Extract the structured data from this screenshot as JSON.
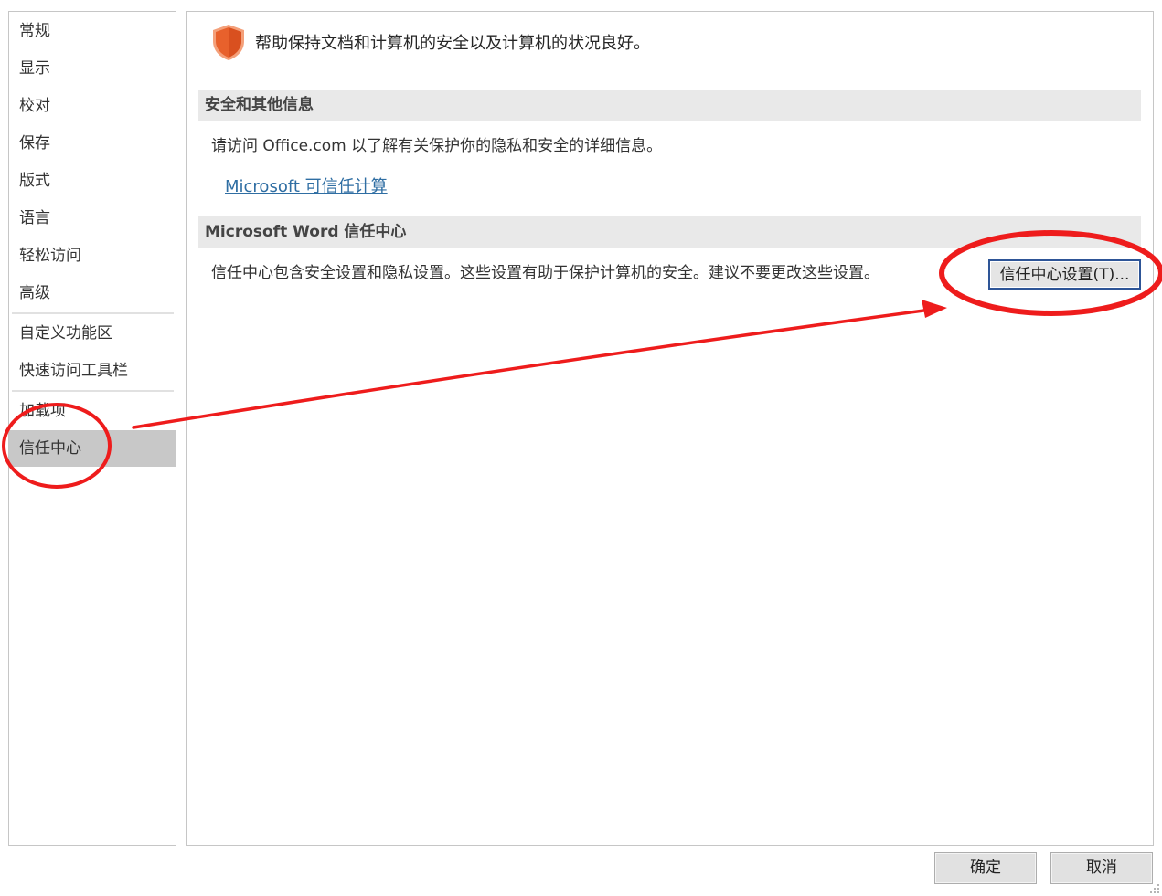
{
  "sidebar": {
    "items": [
      {
        "label": "常规"
      },
      {
        "label": "显示"
      },
      {
        "label": "校对"
      },
      {
        "label": "保存"
      },
      {
        "label": "版式"
      },
      {
        "label": "语言"
      },
      {
        "label": "轻松访问"
      },
      {
        "label": "高级"
      },
      {
        "label": "自定义功能区"
      },
      {
        "label": "快速访问工具栏"
      },
      {
        "label": "加载项"
      },
      {
        "label": "信任中心",
        "selected": true
      }
    ]
  },
  "main": {
    "intro": "帮助保持文档和计算机的安全以及计算机的状况良好。",
    "section1": {
      "title": "安全和其他信息",
      "text": "请访问 Office.com 以了解有关保护你的隐私和安全的详细信息。",
      "link": "Microsoft 可信任计算"
    },
    "section2": {
      "title": "Microsoft Word 信任中心",
      "text": "信任中心包含安全设置和隐私设置。这些设置有助于保护计算机的安全。建议不要更改这些设置。",
      "button": "信任中心设置(T)..."
    }
  },
  "footer": {
    "ok": "确定",
    "cancel": "取消"
  },
  "colors": {
    "shield": "#e8612c",
    "annotation": "#ee1c1c",
    "link": "#2f6ea3",
    "selected_bg": "#c8c8c8",
    "focus_border": "#2e5597"
  }
}
